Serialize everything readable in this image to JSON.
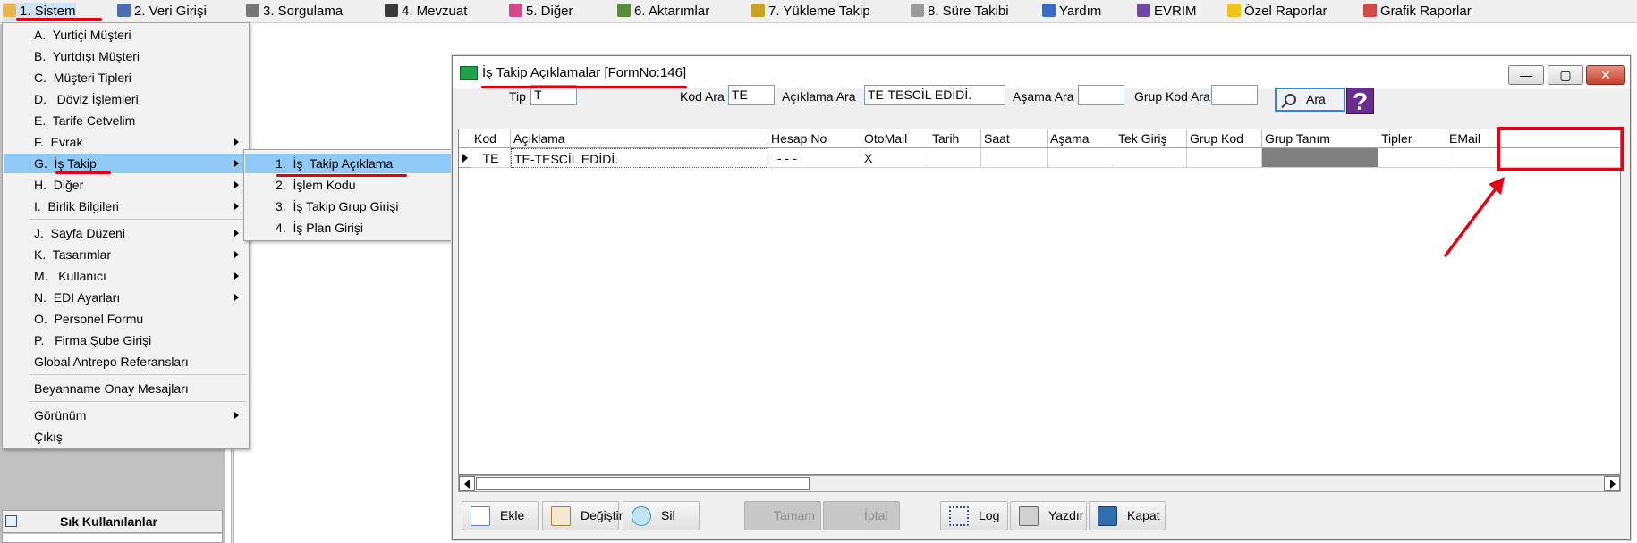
{
  "menubar": {
    "items": [
      {
        "label": "1.  Sistem",
        "icon": "system-icon"
      },
      {
        "label": "2.   Veri Girişi",
        "icon": "data-entry-icon"
      },
      {
        "label": "3.   Sorgulama",
        "icon": "query-icon"
      },
      {
        "label": "4.   Mevzuat",
        "icon": "law-icon"
      },
      {
        "label": "5.   Diğer",
        "icon": "other-icon"
      },
      {
        "label": "6.    Aktarımlar",
        "icon": "transfer-icon"
      },
      {
        "label": "7.   Yükleme Takip",
        "icon": "loading-icon"
      },
      {
        "label": "8. Süre Takibi",
        "icon": "timer-icon"
      },
      {
        "label": "Yardım",
        "icon": "help-icon"
      },
      {
        "label": "EVRIM",
        "icon": "book-icon"
      },
      {
        "label": "Özel Raporlar",
        "icon": "star-icon"
      },
      {
        "label": "Grafik Raporlar",
        "icon": "chart-icon"
      }
    ]
  },
  "sistem_menu": {
    "items": [
      {
        "label": "A.  Yurtiçi Müşteri"
      },
      {
        "label": "B.  Yurtdışı Müşteri"
      },
      {
        "label": "C.  Müşteri Tipleri"
      },
      {
        "label": "D.   Döviz İşlemleri"
      },
      {
        "label": "E.  Tarife Cetvelim"
      },
      {
        "label": "F.  Evrak"
      },
      {
        "label": "G.  İş Takip"
      },
      {
        "label": "H.  Diğer"
      },
      {
        "label": "I.  Birlik Bilgileri"
      },
      {
        "label": "J.  Sayfa Düzeni"
      },
      {
        "label": "K.  Tasarımlar"
      },
      {
        "label": "M.   Kullanıcı"
      },
      {
        "label": "N.  EDI Ayarları"
      },
      {
        "label": "O.  Personel Formu"
      },
      {
        "label": "P.   Firma Şube Girişi"
      },
      {
        "label": "Global Antrepo Referansları"
      },
      {
        "label": "Beyanname Onay Mesajları"
      },
      {
        "label": "Görünüm"
      },
      {
        "label": "Çıkış"
      }
    ]
  },
  "is_takip_submenu": {
    "items": [
      {
        "label": "1.  İş  Takip Açıklama"
      },
      {
        "label": "2.  İşlem Kodu"
      },
      {
        "label": "3.  İş Takip Grup Girişi"
      },
      {
        "label": "4.  İş Plan Girişi"
      }
    ]
  },
  "left_panel": {
    "header": "Sık Kullanılanlar"
  },
  "form": {
    "title": "İş Takip Açıklamalar [FormNo:146]",
    "window_buttons": {
      "minimize": "—",
      "maximize": "▢",
      "close": "✕"
    },
    "filters": {
      "tip_label": "Tip",
      "tip_value": "T",
      "kod_ara_label": "Kod Ara",
      "kod_ara_value": "TE",
      "aciklama_ara_label": "Açıklama  Ara",
      "aciklama_ara_value": "TE-TESCİL EDİDİ.",
      "asama_ara_label": "Aşama Ara",
      "asama_ara_value": "",
      "grup_kod_ara_label": "Grup Kod Ara",
      "grup_kod_ara_value": "",
      "ara_button": "Ara",
      "help_button": "?"
    },
    "grid": {
      "columns": [
        "Kod",
        "Açıklama",
        "Hesap No",
        "OtoMail",
        "Tarih",
        "Saat",
        "Aşama",
        "Tek Giriş",
        "Grup Kod",
        "Grup Tanım",
        "Tipler",
        "EMail"
      ],
      "rows": [
        {
          "kod": "TE",
          "aciklama": "TE-TESCİL EDİDİ.",
          "hesap_no": "- - -",
          "otomail": "X",
          "tarih": "",
          "saat": "",
          "asama": "",
          "tek_giris": "",
          "grup_kod": "",
          "grup_tanim": "",
          "tipler": "",
          "email": ""
        }
      ]
    },
    "toolbar": {
      "ekle": "Ekle",
      "degistir": "Değiştir",
      "sil": "Sil",
      "tamam": "Tamam",
      "iptal": "İptal",
      "log": "Log",
      "yazdir": "Yazdır",
      "kapat": "Kapat"
    }
  },
  "colors": {
    "menu_highlight": "#91c9f7",
    "annotation_red": "#e60012",
    "grup_tanim_cell": "#808080"
  }
}
